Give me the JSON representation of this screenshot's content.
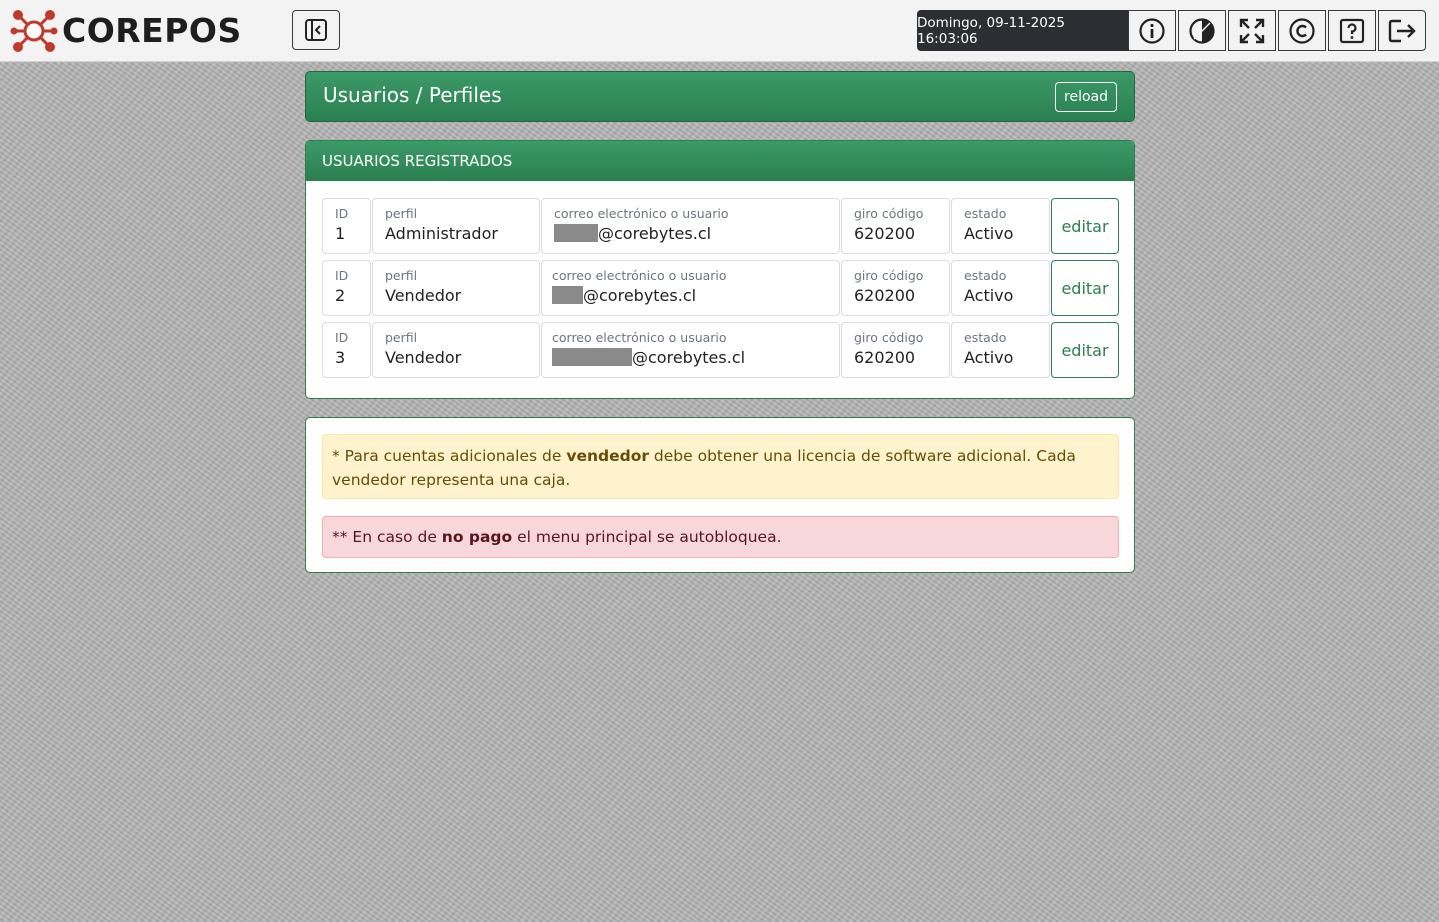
{
  "brand": {
    "name": "COREPOS"
  },
  "header": {
    "datetime": "Domingo, 09-11-2025 16:03:06",
    "buttons": [
      "sidebar-toggle-icon",
      "info-icon",
      "theme-contrast-icon",
      "fullscreen-icon",
      "copyright-icon",
      "help-icon",
      "logout-icon"
    ]
  },
  "page": {
    "title": "Usuarios / Perfiles",
    "reload_label": "reload"
  },
  "users": {
    "heading": "USUARIOS REGISTRADOS",
    "labels": {
      "id": "ID",
      "perfil": "perfil",
      "correo": "correo electrónico o usuario",
      "giro": "giro código",
      "estado": "estado"
    },
    "edit_label": "editar",
    "rows": [
      {
        "id": "1",
        "perfil": "Administrador",
        "email_domain": "@corebytes.cl",
        "giro": "620200",
        "estado": "Activo"
      },
      {
        "id": "2",
        "perfil": "Vendedor",
        "email_domain": "@corebytes.cl",
        "giro": "620200",
        "estado": "Activo"
      },
      {
        "id": "3",
        "perfil": "Vendedor",
        "email_domain": "@corebytes.cl",
        "giro": "620200",
        "estado": "Activo"
      }
    ]
  },
  "notes": {
    "warning": {
      "pre": "* Para cuentas adicionales de ",
      "bold": "vendedor",
      "post": " debe obtener una licencia de software adicional. Cada vendedor representa una caja."
    },
    "danger": {
      "pre": "** En caso de ",
      "bold": "no pago",
      "post": " el menu principal se autobloquea."
    }
  },
  "colors": {
    "primary": "#2b7f50",
    "header_bg": "#f3f3f3",
    "datetime_bg": "#2b2f33",
    "warning_bg": "#fff3cd",
    "danger_bg": "#f8d7da"
  }
}
